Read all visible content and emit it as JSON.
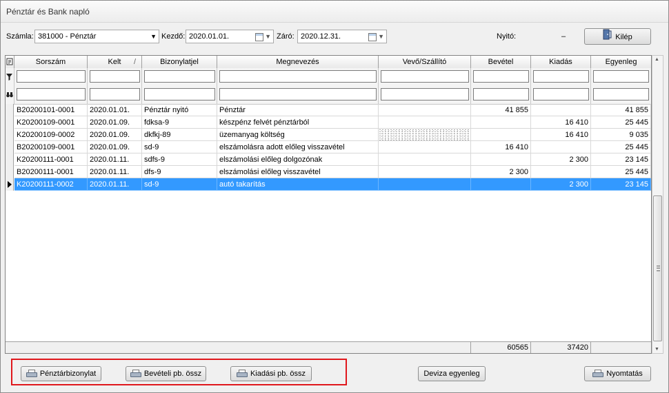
{
  "window": {
    "title": "Pénztár és Bank napló"
  },
  "toolbar": {
    "account_label": "Számla:",
    "account_value": "381000 - Pénztár",
    "start_label": "Kezdő:",
    "start_value": "2020.01.01.",
    "end_label": "Záró:",
    "end_value": "2020.12.31.",
    "opening_label": "Nyitó:",
    "opening_value": "–",
    "exit_label": "Kilép"
  },
  "grid": {
    "columns": [
      "Sorszám",
      "Kelt",
      "Bizonylatjel",
      "Megnevezés",
      "Vevő/Szállító",
      "Bevétel",
      "Kiadás",
      "Egyenleg"
    ],
    "sort_indicator": "/",
    "rows": [
      [
        "B20200101-0001",
        "2020.01.01.",
        "Pénztár nyitó",
        "Pénztár",
        "",
        "41 855",
        "",
        "41 855"
      ],
      [
        "K20200109-0001",
        "2020.01.09.",
        "fdksa-9",
        "készpénz felvét pénztárból",
        "",
        "",
        "16 410",
        "25 445"
      ],
      [
        "K20200109-0002",
        "2020.01.09.",
        "dkfkj-89",
        "üzemanyag költség",
        "",
        "",
        "16 410",
        "9 035"
      ],
      [
        "B20200109-0001",
        "2020.01.09.",
        "sd-9",
        "elszámolásra adott előleg visszavétel",
        "",
        "16 410",
        "",
        "25 445"
      ],
      [
        "K20200111-0001",
        "2020.01.11.",
        "sdfs-9",
        "elszámolási előleg dolgozónak",
        "",
        "",
        "2 300",
        "23 145"
      ],
      [
        "B20200111-0001",
        "2020.01.11.",
        "dfs-9",
        "elszámolási előleg visszavétel",
        "",
        "2 300",
        "",
        "25 445"
      ],
      [
        "K20200111-0002",
        "2020.01.11.",
        "sd-9",
        "autó takarítás",
        "",
        "",
        "2 300",
        "23 145"
      ]
    ],
    "totals": {
      "income": "60565",
      "expense": "37420"
    }
  },
  "bottom": {
    "cash_voucher": "Pénztárbizonylat",
    "income_summary": "Bevételi pb. össz",
    "expense_summary": "Kiadási pb. össz",
    "currency_balance": "Deviza egyenleg",
    "print": "Nyomtatás"
  },
  "colors": {
    "selection": "#3399ff",
    "highlight_border": "#e0161b"
  }
}
